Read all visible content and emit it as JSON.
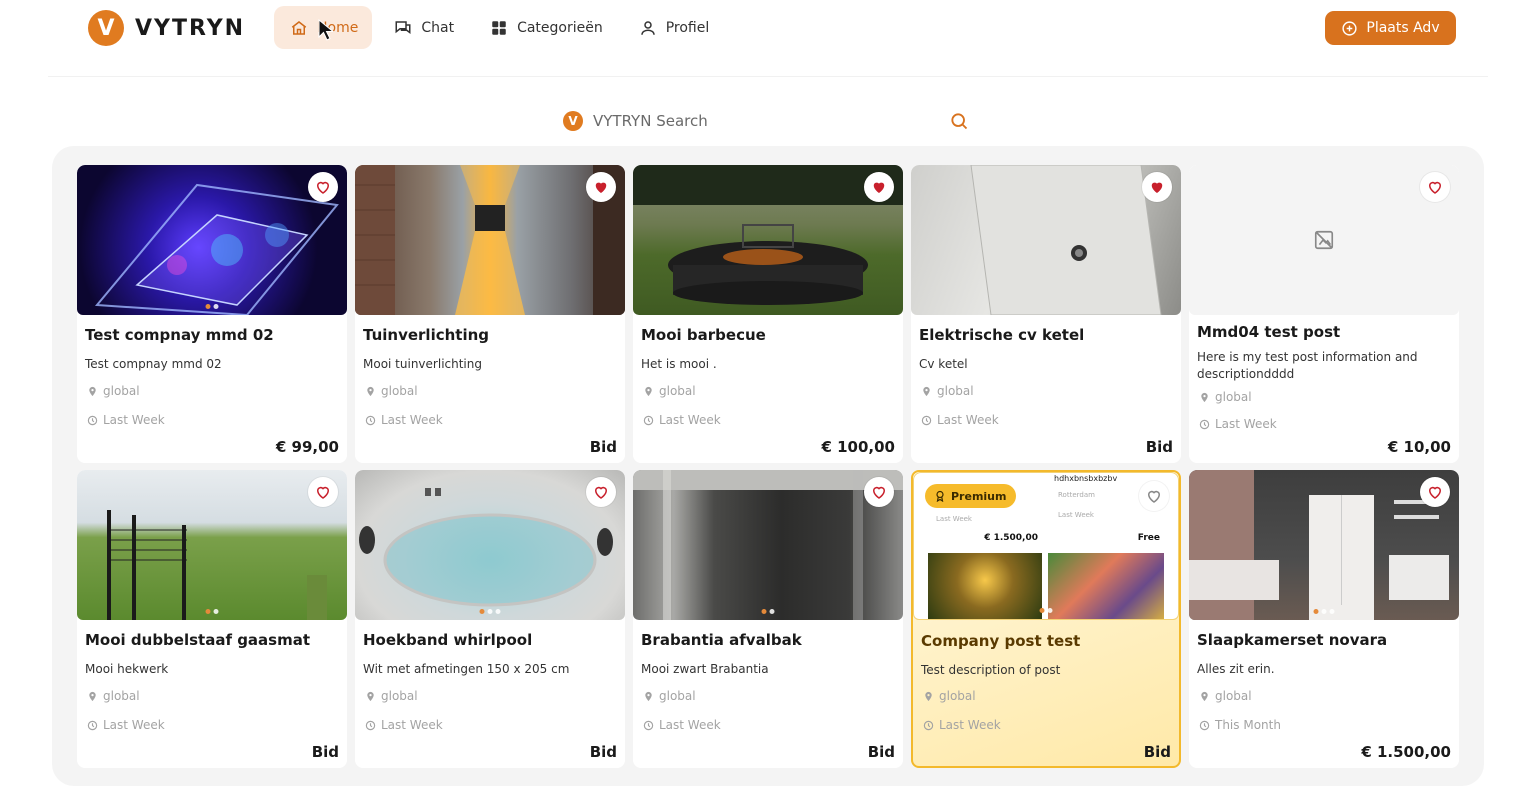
{
  "brand": {
    "name": "VYTRYN",
    "badge": "V"
  },
  "nav": {
    "items": [
      {
        "label": "Home",
        "icon": "home-icon",
        "active": true
      },
      {
        "label": "Chat",
        "icon": "chat-icon",
        "active": false
      },
      {
        "label": "Categorieën",
        "icon": "grid-icon",
        "active": false
      },
      {
        "label": "Profiel",
        "icon": "user-icon",
        "active": false
      }
    ],
    "post_button": "Plaats Adv"
  },
  "search": {
    "placeholder": "VYTRYN Search",
    "badge": "V"
  },
  "colors": {
    "accent": "#d8721e",
    "premium": "#f3b92c",
    "favorite": "#c8202c"
  },
  "listings": [
    {
      "title": "Test compnay mmd 02",
      "description": "Test compnay mmd 02",
      "location": "global",
      "time": "Last Week",
      "price": "€ 99,00",
      "favorited": false
    },
    {
      "title": "Tuinverlichting",
      "description": "Mooi tuinverlichting",
      "location": "global",
      "time": "Last Week",
      "price": "Bid",
      "favorited": true
    },
    {
      "title": "Mooi barbecue",
      "description": "Het is mooi .",
      "location": "global",
      "time": "Last Week",
      "price": "€ 100,00",
      "favorited": true
    },
    {
      "title": "Elektrische cv ketel",
      "description": "Cv ketel",
      "location": "global",
      "time": "Last Week",
      "price": "Bid",
      "favorited": true
    },
    {
      "title": "Mmd04 test post",
      "description": "Here is my test post information and descriptiondddd",
      "location": "global",
      "time": "Last Week",
      "price": "€ 10,00",
      "favorited": false
    },
    {
      "title": "Mooi dubbelstaaf gaasmat",
      "description": "Mooi hekwerk",
      "location": "global",
      "time": "Last Week",
      "price": "Bid",
      "favorited": false
    },
    {
      "title": "Hoekband whirlpool",
      "description": "Wit met afmetingen 150 x 205 cm",
      "location": "global",
      "time": "Last Week",
      "price": "Bid",
      "favorited": false
    },
    {
      "title": "Brabantia afvalbak",
      "description": "Mooi zwart Brabantia",
      "location": "global",
      "time": "Last Week",
      "price": "Bid",
      "favorited": false
    },
    {
      "title": "Company post test",
      "description": "Test description of post",
      "location": "global",
      "time": "Last Week",
      "price": "Bid",
      "favorited": false,
      "premium": true,
      "premium_label": "Premium",
      "preview": {
        "top_text": "hdhxbnsbxbzbv",
        "location": "Rotterdam",
        "time": "Last Week",
        "price_left": "€ 1.500,00",
        "price_right": "Free"
      }
    },
    {
      "title": "Slaapkamerset novara",
      "description": "Alles zit erin.",
      "location": "global",
      "time": "This Month",
      "price": "€ 1.500,00",
      "favorited": false
    }
  ]
}
